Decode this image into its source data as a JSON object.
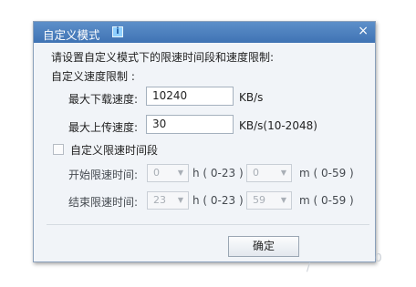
{
  "dialog": {
    "title": "自定义模式",
    "info_icon": "i",
    "close_icon": "×",
    "instruction": "请设置自定义模式下的限速时间段和速度限制:",
    "speed_section_label": "自定义速度限制 :",
    "download": {
      "label": "最大下载速度:",
      "value": "10240",
      "unit": "KB/s"
    },
    "upload": {
      "label": "最大上传速度:",
      "value": "30",
      "unit": "KB/s(10-2048)"
    },
    "time_period": {
      "checkbox_label": "自定义限速时间段",
      "checked": false,
      "start": {
        "label": "开始限速时间:",
        "hour": "0",
        "hour_range": "h ( 0-23 )",
        "minute": "0",
        "minute_range": "m ( 0-59 )"
      },
      "end": {
        "label": "结束限速时间:",
        "hour": "23",
        "hour_range": "h ( 0-23 )",
        "minute": "59",
        "minute_range": "m ( 0-59 )"
      }
    },
    "ok_button": "确定"
  },
  "icons": {
    "info": "info-icon",
    "close": "close-icon",
    "dropdown": "chevron-down-icon"
  },
  "colors": {
    "titlebar": "#4a7fbf",
    "dialog_bg": "#f1f4f8"
  }
}
